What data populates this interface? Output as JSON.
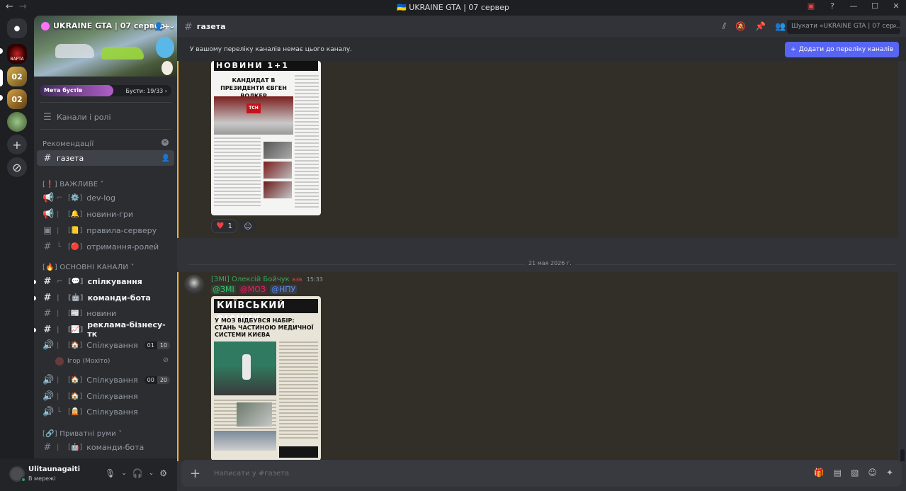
{
  "window": {
    "title": "UKRAINE GTA | 07 сервер",
    "title_emoji": "🇺🇦"
  },
  "servers": {
    "items": [
      {
        "name": "dm",
        "icon": "discord-icon"
      },
      {
        "name": "server-1",
        "label": "BAPTA"
      },
      {
        "name": "server-2",
        "label": "02"
      },
      {
        "name": "server-3",
        "label": "02"
      },
      {
        "name": "server-4",
        "label": ""
      },
      {
        "name": "add-server",
        "icon": "plus-icon"
      },
      {
        "name": "explore",
        "icon": "compass-icon"
      }
    ]
  },
  "sidebar": {
    "server_name": "UKRAINE GTA | 07 сервер",
    "boost": {
      "label": "Мета бустів",
      "count": "Бусти: 19/33 ›",
      "progress": 0.576
    },
    "channels_roles": "Канали і ролі",
    "recommendations_label": "Рекомендації",
    "recommended_channel": "газета",
    "categories": [
      {
        "label": "[❗] ВАЖЛИВЕ ˅"
      },
      {
        "label": "[🔥] ОСНОВНІ КАНАЛИ ˅"
      },
      {
        "label": "[🔗] Приватні руми ˅"
      }
    ],
    "channels": [
      {
        "name": "dev-log",
        "emoji": "[⚙️]"
      },
      {
        "name": "новини-гри",
        "emoji": "[🔔]"
      },
      {
        "name": "правила-серверу",
        "emoji": "[📒]"
      },
      {
        "name": "отримання-ролей",
        "emoji": "[🔴]"
      },
      {
        "name": "спілкування",
        "emoji": "[💬]"
      },
      {
        "name": "команди-бота",
        "emoji": "[🤖]"
      },
      {
        "name": "новини",
        "emoji": "[📰]"
      },
      {
        "name": "реклама-бізнесу-тк",
        "emoji": "[📈]"
      },
      {
        "name": "Спілкування",
        "emoji": "[🏠]",
        "count_a": "01",
        "count_b": "10"
      },
      {
        "name": "Спілкування",
        "emoji": "[🏠]",
        "count_a": "00",
        "count_b": "20"
      },
      {
        "name": "Спілкування",
        "emoji": "[🏠]"
      },
      {
        "name": "Спілкування",
        "emoji": "[🧝]"
      },
      {
        "name": "команди-бота",
        "emoji": "[🤖]"
      }
    ],
    "voice_user": "Ігор (Мохіто)"
  },
  "user": {
    "name": "Ulitaunagaiti",
    "status": "В мережі"
  },
  "channel": {
    "name": "газета",
    "search_placeholder": "Шукати «UKRAINE GTA | 07 сер…"
  },
  "notice": {
    "text": "У вашому переліку каналів немає цього каналу.",
    "button": "Додати до переліку каналів"
  },
  "messages": [
    {
      "newspaper": {
        "masthead": "НОВИНИ 1+1",
        "headline": "КАНДИДАТ В ПРЕЗИДЕНТИ ЄВГЕН ВОЛКЕР",
        "logo": "ТСН"
      },
      "reaction_count": "1"
    },
    {
      "date_divider": "21 мая 2026 г.",
      "author": "[ЗМІ] Олексій Бойчук",
      "badge": "БЗБ",
      "time": "15:33",
      "mentions": [
        "@ЗМІ",
        "@МОЗ",
        "@НПУ"
      ],
      "newspaper": {
        "masthead": "КИЇВСЬКИЙ ВІСНИК",
        "headline": "У МОЗ ВІДБУВСЯ НАБІР: СТАНЬ ЧАСТИНОЮ МЕДИЧНОЇ СИСТЕМИ КИЄВА"
      }
    }
  ],
  "composer": {
    "placeholder": "Написати у #газета"
  },
  "colors": {
    "accent": "#5865f2",
    "online": "#23a55a",
    "highlight_border": "#f0b232",
    "author": "#3ba55d"
  }
}
